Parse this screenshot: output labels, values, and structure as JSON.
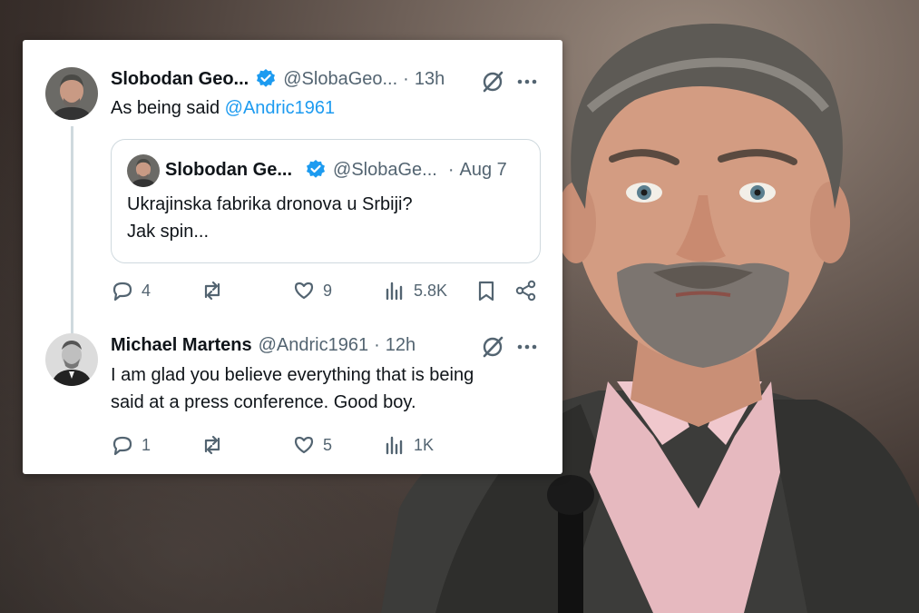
{
  "tweet_main": {
    "name": "Slobodan Geo...",
    "handle": "@SlobaGeo...",
    "separator": "·",
    "time": "13h",
    "text": "As being said ",
    "mention": "@Andric1961",
    "stats": {
      "replies": "4",
      "reposts": "",
      "likes": "9",
      "views": "5.8K"
    }
  },
  "quoted_tweet": {
    "name": "Slobodan Ge...",
    "handle": "@SlobaGe...",
    "separator": "·",
    "time": "Aug 7",
    "line1": "Ukrajinska fabrika dronova u Srbiji?",
    "line2": "Jak spin..."
  },
  "tweet_reply": {
    "name": "Michael Martens",
    "handle": "@Andric1961",
    "separator": "·",
    "time": "12h",
    "line1": "I am glad you believe everything that is being",
    "line2": "said at a press conference. Good boy.",
    "stats": {
      "replies": "1",
      "reposts": "",
      "likes": "5",
      "views": "1K"
    }
  },
  "colors": {
    "accent": "#1d9bf0",
    "text": "#0f1419",
    "muted": "#536471"
  }
}
